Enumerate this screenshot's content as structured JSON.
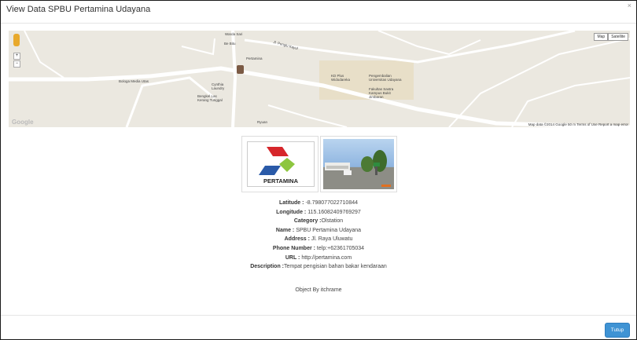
{
  "modal": {
    "title": "View Data SPBU Pertamina Udayana",
    "close": "×"
  },
  "map": {
    "buttons": {
      "map": "Map",
      "satellite": "Satellite"
    },
    "zoom_in": "+",
    "zoom_out": "−",
    "labels": [
      "Warda Sari",
      "Be Bitu",
      "Pertamina",
      "Jl. Penglu Kayul",
      "Bologa Media Utas",
      "Cynthia Laundry",
      "Bengkel Las Kerang Tunggal",
      "KD Plus Widodareka",
      "Pengembalian Universitas Udayana",
      "Fakultas Sastra Kampus Bukit Jimbaran",
      "Ryuan"
    ],
    "attribution": "Map data ©2014 Google   50 m   Terms of Use   Report a map error",
    "google": "Google"
  },
  "images": {
    "logo_text": "PERTAMINA"
  },
  "details": {
    "latitude_label": "Latitude :",
    "latitude_value": "-8.798077022710844",
    "longitude_label": "Longitude :",
    "longitude_value": "115.16082409769297",
    "category_label": "Category :",
    "category_value": "Olstation",
    "name_label": "Name :",
    "name_value": "SPBU Pertamina Udayana",
    "address_label": "Address :",
    "address_value": "Jl. Raya Uluwatu",
    "phone_label": "Phone Number :",
    "phone_value": "telp:+62361705034",
    "url_label": "URL :",
    "url_value": "http://pertamina.com",
    "description_label": "Description :",
    "description_value": "Tempat pengisian bahan bakar kendaraan"
  },
  "object_by": "Object By itchrame",
  "footer": {
    "close_label": "Tutup"
  },
  "colors": {
    "button": "#3f93d4",
    "map_bg": "#ebe8e0"
  }
}
